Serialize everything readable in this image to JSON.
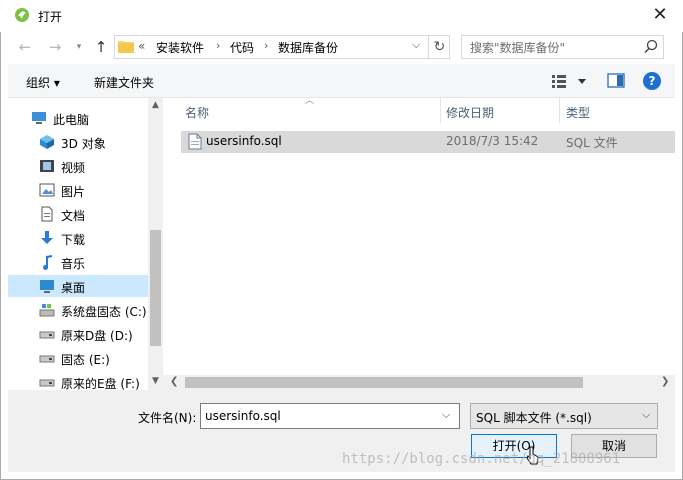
{
  "window": {
    "title": "打开",
    "close_glyph": "✕"
  },
  "address": {
    "overflow_glyph": "«",
    "crumbs": [
      "安装软件",
      "代码",
      "数据库备份"
    ],
    "separator": "›",
    "search_placeholder": "搜索\"数据库备份\""
  },
  "toolbar": {
    "organize": "组织 ▾",
    "new_folder": "新建文件夹",
    "help": "?"
  },
  "nav": {
    "items": [
      {
        "label": "此电脑",
        "icon": "computer-icon"
      },
      {
        "label": "3D 对象",
        "icon": "3d-objects-icon"
      },
      {
        "label": "视频",
        "icon": "video-icon"
      },
      {
        "label": "图片",
        "icon": "pictures-icon"
      },
      {
        "label": "文档",
        "icon": "documents-icon"
      },
      {
        "label": "下载",
        "icon": "download-icon"
      },
      {
        "label": "音乐",
        "icon": "music-icon"
      },
      {
        "label": "桌面",
        "icon": "desktop-icon",
        "selected": true
      },
      {
        "label": "系统盘固态 (C:)",
        "icon": "system-drive-icon"
      },
      {
        "label": "原来D盘 (D:)",
        "icon": "drive-icon"
      },
      {
        "label": "固态 (E:)",
        "icon": "drive-icon"
      },
      {
        "label": "原来的E盘 (F:)",
        "icon": "drive-icon"
      }
    ]
  },
  "files": {
    "columns": [
      "名称",
      "修改日期",
      "类型"
    ],
    "rows": [
      {
        "name": "usersinfo.sql",
        "modified": "2018/7/3 15:42",
        "type": "SQL 文件"
      }
    ]
  },
  "bottom": {
    "filename_label": "文件名(N):",
    "filename_value": "usersinfo.sql",
    "filetype_value": "SQL 脚本文件 (*.sql)",
    "open_label": "打开(O)",
    "cancel_label": "取消"
  },
  "watermark": "https://blog.csdn.net/qq_21808961",
  "colors": {
    "accent": "#0078d7",
    "selection": "#cce8ff",
    "row_selected": "#d9d9d9"
  }
}
